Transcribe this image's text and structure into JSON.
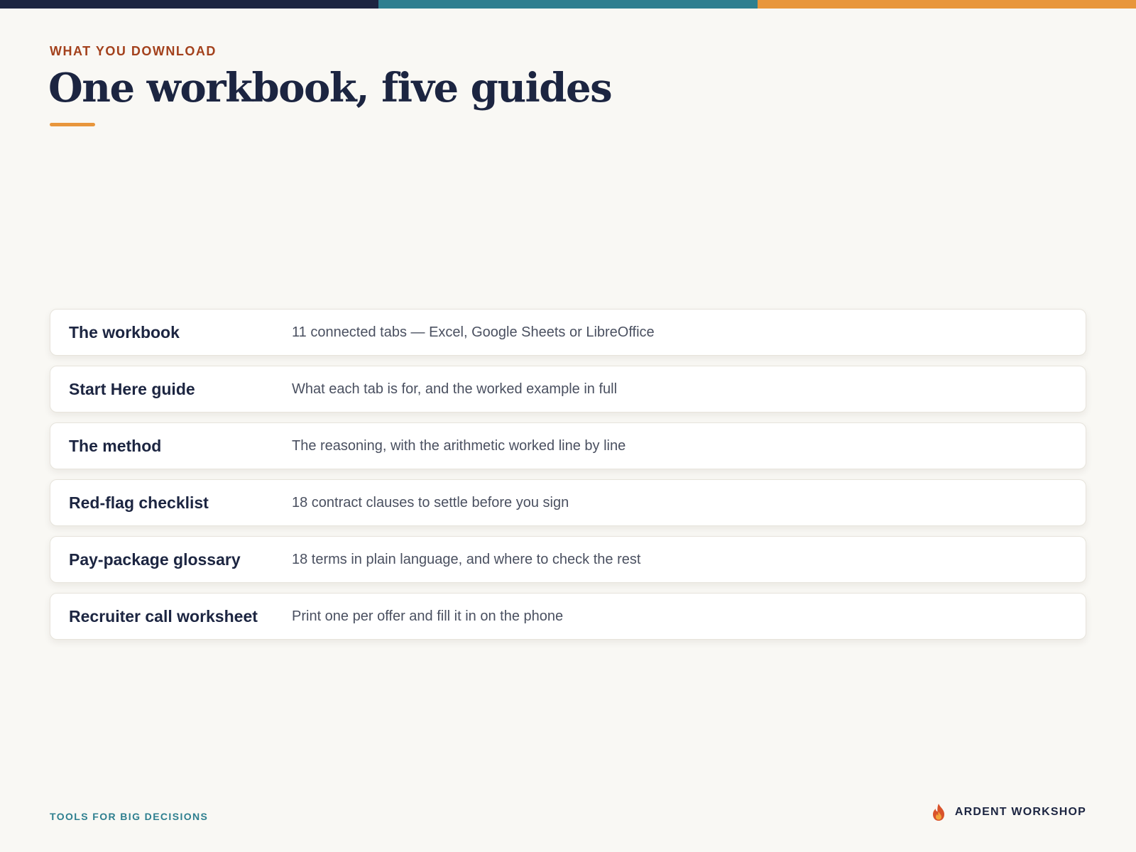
{
  "colors": {
    "navy": "#1c2541",
    "teal": "#2e7f8f",
    "orange": "#e8963c",
    "rust": "#a3411c",
    "background": "#f9f8f4"
  },
  "topbar": [
    "#1c2541",
    "#2e7f8f",
    "#e8963c"
  ],
  "header": {
    "eyebrow": "WHAT YOU DOWNLOAD",
    "title": "One workbook, five guides"
  },
  "items": [
    {
      "label": "The workbook",
      "description": "11 connected tabs — Excel, Google Sheets or LibreOffice"
    },
    {
      "label": "Start Here guide",
      "description": "What each tab is for, and the worked example in full"
    },
    {
      "label": "The method",
      "description": "The reasoning, with the arithmetic worked line by line"
    },
    {
      "label": "Red-flag checklist",
      "description": "18 contract clauses to settle before you sign"
    },
    {
      "label": "Pay-package glossary",
      "description": "18 terms in plain language, and where to check the rest"
    },
    {
      "label": "Recruiter call worksheet",
      "description": "Print one per offer and fill it in on the phone"
    }
  ],
  "footer": {
    "tagline": "TOOLS FOR BIG DECISIONS",
    "brand_icon": "flame-icon",
    "brand_name": "ARDENT WORKSHOP"
  }
}
